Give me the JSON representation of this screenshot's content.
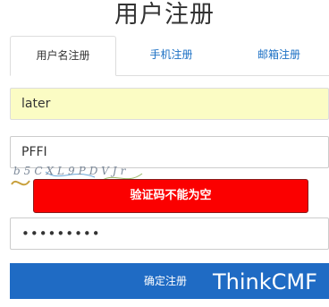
{
  "page": {
    "title": "用户注册"
  },
  "tabs": [
    {
      "label": "用户名注册",
      "active": true
    },
    {
      "label": "手机注册",
      "active": false
    },
    {
      "label": "邮箱注册",
      "active": false
    }
  ],
  "form": {
    "username_value": "later",
    "captcha_value": "PFFI",
    "password_value": "•••••••••",
    "submit_label": "确定注册"
  },
  "captcha_image": {
    "text": "b5CXL9PDVJr"
  },
  "toast": {
    "message": "验证码不能为空",
    "color": "#fb0000"
  },
  "brand": {
    "text": "ThinkCMF"
  },
  "colors": {
    "accent": "#1f6bc4",
    "autofill": "#fbfcc4"
  }
}
